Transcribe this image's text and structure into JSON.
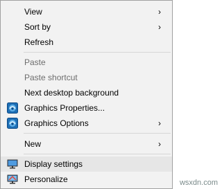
{
  "context_menu": {
    "items": [
      {
        "label": "View",
        "has_submenu": true,
        "disabled": false
      },
      {
        "label": "Sort by",
        "has_submenu": true,
        "disabled": false
      },
      {
        "label": "Refresh",
        "has_submenu": false,
        "disabled": false
      },
      {
        "label": "Paste",
        "has_submenu": false,
        "disabled": true
      },
      {
        "label": "Paste shortcut",
        "has_submenu": false,
        "disabled": true
      },
      {
        "label": "Next desktop background",
        "has_submenu": false,
        "disabled": false
      },
      {
        "label": "Graphics Properties...",
        "has_submenu": false,
        "disabled": false,
        "icon": "intel-graphics-icon"
      },
      {
        "label": "Graphics Options",
        "has_submenu": true,
        "disabled": false,
        "icon": "intel-graphics-icon"
      },
      {
        "label": "New",
        "has_submenu": true,
        "disabled": false
      },
      {
        "label": "Display settings",
        "has_submenu": false,
        "disabled": false,
        "highlighted": true,
        "icon": "monitor-icon"
      },
      {
        "label": "Personalize",
        "has_submenu": false,
        "disabled": false,
        "icon": "personalize-monitor-icon"
      }
    ],
    "submenu_arrow": "›"
  },
  "watermark": "wsxdn.com",
  "colors": {
    "menu_background": "#f2f2f2",
    "menu_border": "#a0a0a0",
    "highlight": "#e6e6e6",
    "disabled_text": "#6d6d6d",
    "separator": "#d7d7d7"
  }
}
